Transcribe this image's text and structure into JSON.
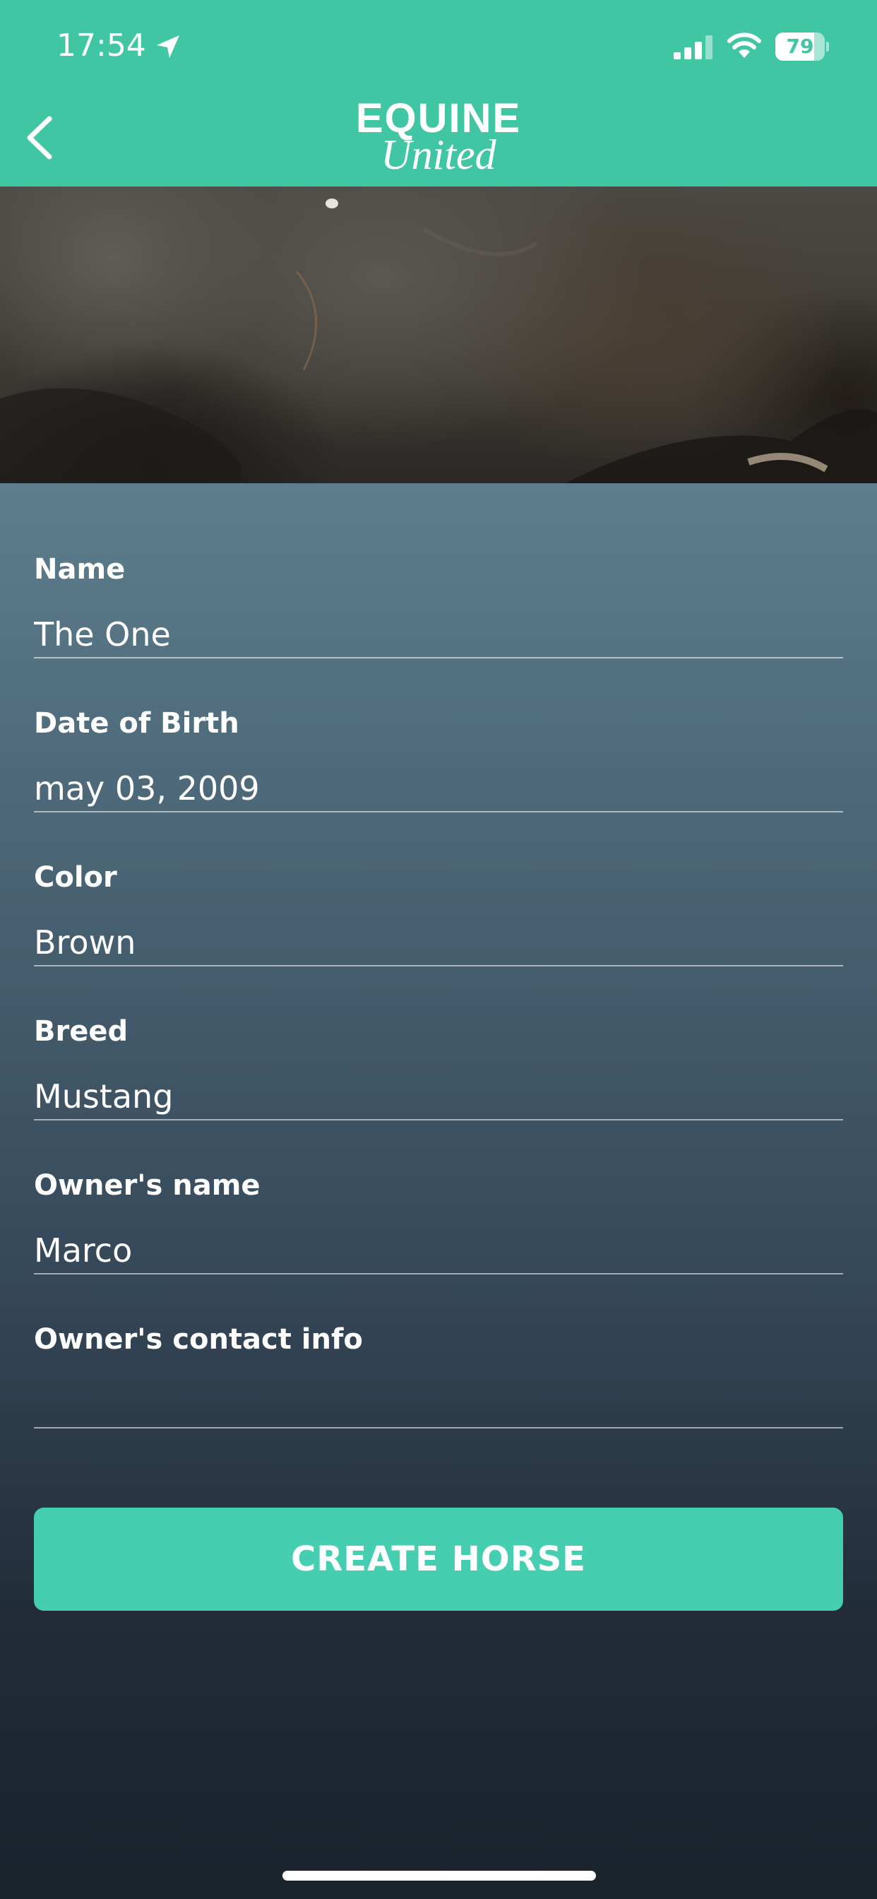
{
  "status_bar": {
    "time": "17:54",
    "battery_percent": "79",
    "battery_level": 0.79,
    "icons": [
      "location-arrow-icon",
      "signal-icon",
      "wifi-icon",
      "battery-icon"
    ]
  },
  "header": {
    "back_icon": "chevron-left-icon",
    "logo_line1": "EQUINE",
    "logo_line2": "United",
    "background_color": "#41c6a4"
  },
  "form": {
    "fields": [
      {
        "label": "Name",
        "value": "The One"
      },
      {
        "label": "Date of Birth",
        "value": "may 03, 2009"
      },
      {
        "label": "Color",
        "value": "Brown"
      },
      {
        "label": "Breed",
        "value": "Mustang"
      },
      {
        "label": "Owner's name",
        "value": "Marco"
      },
      {
        "label": "Owner's contact info",
        "value": ""
      }
    ]
  },
  "actions": {
    "create_label": "CREATE HORSE",
    "button_color": "#45cfb0"
  }
}
